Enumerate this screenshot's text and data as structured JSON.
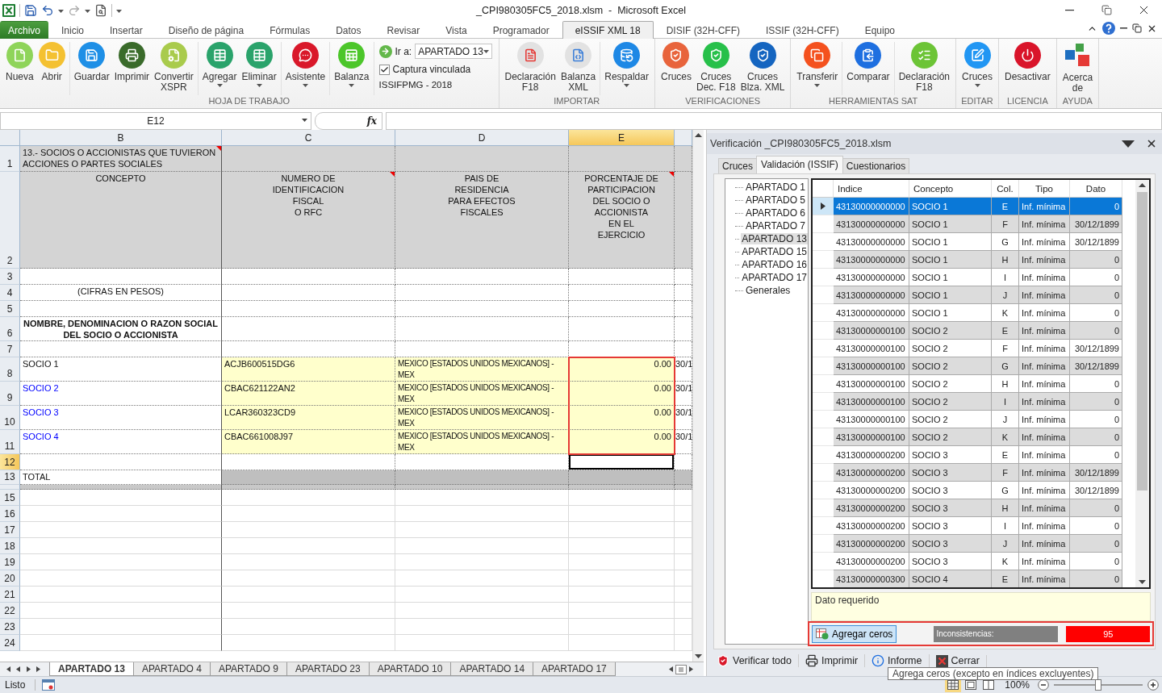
{
  "window": {
    "title": "_CPI980305FC5_2018.xlsm  -  Microsoft Excel"
  },
  "ribbon_tabs": [
    {
      "label": "Archivo",
      "kind": "file",
      "selected": false
    },
    {
      "label": "Inicio",
      "kind": "tab",
      "selected": false
    },
    {
      "label": "Insertar",
      "kind": "tab",
      "selected": false
    },
    {
      "label": "Diseño de página",
      "kind": "tab",
      "selected": false
    },
    {
      "label": "Fórmulas",
      "kind": "tab",
      "selected": false
    },
    {
      "label": "Datos",
      "kind": "tab",
      "selected": false
    },
    {
      "label": "Revisar",
      "kind": "tab",
      "selected": false
    },
    {
      "label": "Vista",
      "kind": "tab",
      "selected": false
    },
    {
      "label": "Programador",
      "kind": "tab",
      "selected": false
    },
    {
      "label": "eISSIF XML 18",
      "kind": "tab",
      "selected": true
    },
    {
      "label": "DISIF (32H-CFF)",
      "kind": "tab",
      "selected": false
    },
    {
      "label": "ISSIF (32H-CFF)",
      "kind": "tab",
      "selected": false
    },
    {
      "label": "Equipo",
      "kind": "tab",
      "selected": false
    }
  ],
  "ribbon_groups": [
    {
      "label": "HOJA DE TRABAJO",
      "sections": [
        [
          {
            "label": "Nueva",
            "kind": "round",
            "color": "#8fd45a",
            "dropdown": false
          },
          {
            "label": "Abrir",
            "kind": "round",
            "color": "#f4c132",
            "dropdown": false
          }
        ],
        [
          {
            "label": "Guardar",
            "kind": "round",
            "color": "#1e8fe6",
            "dropdown": false
          },
          {
            "label": "Imprimir",
            "kind": "round",
            "color": "#3a6b2b",
            "dropdown": false
          },
          {
            "label": "Convertir\nXSPR",
            "kind": "round",
            "color": "#a9cb4c",
            "dropdown": false
          }
        ],
        [
          {
            "label": "Agregar",
            "kind": "round",
            "color": "#2aa36b",
            "dropdown": true
          },
          {
            "label": "Eliminar",
            "kind": "round",
            "color": "#2aa36b",
            "dropdown": true
          }
        ],
        [
          {
            "label": "Asistente",
            "kind": "round",
            "color": "#d9182a",
            "dropdown": true
          }
        ],
        [
          {
            "label": "Balanza",
            "kind": "round",
            "color": "#4cc62a",
            "dropdown": true
          }
        ]
      ],
      "panel": {
        "goto_label": "Ir a:",
        "goto_value": "APARTADO 13",
        "checkbox_label": "Captura vinculada",
        "checked": true,
        "caption": "ISSIFPMG - 2018"
      }
    },
    {
      "label": "IMPORTAR",
      "sections": [
        [
          {
            "label": "Declaración\nF18",
            "kind": "round",
            "color": "#e2e2e2",
            "dropdown": false
          },
          {
            "label": "Balanza\nXML",
            "kind": "round",
            "color": "#e2e2e2",
            "dropdown": false
          }
        ],
        [
          {
            "label": "Respaldar",
            "kind": "round",
            "color": "#1e88e5",
            "dropdown": true
          }
        ]
      ]
    },
    {
      "label": "VERIFICACIONES",
      "sections": [
        [
          {
            "label": "Cruces",
            "kind": "round",
            "color": "#e8643c",
            "dropdown": false
          },
          {
            "label": "Cruces\nDec. F18",
            "kind": "round",
            "color": "#27c04a",
            "dropdown": false
          },
          {
            "label": "Cruces\nBlza. XML",
            "kind": "round",
            "color": "#1565c0",
            "dropdown": false
          }
        ]
      ]
    },
    {
      "label": "HERRAMIENTAS SAT",
      "sections": [
        [
          {
            "label": "Transferir",
            "kind": "round",
            "color": "#f4511e",
            "dropdown": true
          }
        ],
        [
          {
            "label": "Comparar",
            "kind": "round",
            "color": "#1e6fe0",
            "dropdown": false
          }
        ],
        [
          {
            "label": "Declaración\nF18",
            "kind": "round",
            "color": "#6cc436",
            "dropdown": false
          }
        ]
      ]
    },
    {
      "label": "EDITAR",
      "sections": [
        [
          {
            "label": "Cruces",
            "kind": "round",
            "color": "#2196f3",
            "dropdown": true
          }
        ]
      ]
    },
    {
      "label": "LICENCIA",
      "sections": [
        [
          {
            "label": "Desactivar",
            "kind": "round",
            "color": "#d9142a",
            "dropdown": false
          }
        ]
      ]
    },
    {
      "label": "AYUDA",
      "sections": [
        [
          {
            "label": "Acerca\nde",
            "kind": "tiles",
            "color": "#e53935",
            "dropdown": false
          }
        ]
      ]
    }
  ],
  "formula_bar": {
    "name_box": "E12",
    "fx_label": "fx"
  },
  "sheet": {
    "columns": [
      {
        "label": "B",
        "selected": false
      },
      {
        "label": "C",
        "selected": false
      },
      {
        "label": "D",
        "selected": false
      },
      {
        "label": "E",
        "selected": true
      },
      {
        "selected": false
      }
    ],
    "rows": [
      {
        "number": "1",
        "kind": "title",
        "selected": false,
        "cells": [
          "13.- SOCIOS O ACCIONISTAS QUE TUVIERON\nACCIONES O PARTES SOCIALES"
        ],
        "comments": [
          true,
          false,
          false,
          false,
          false
        ]
      },
      {
        "number": "2",
        "kind": "header",
        "selected": false,
        "cells": [
          "CONCEPTO",
          "NUMERO DE\nIDENTIFICACION\nFISCAL\nO RFC",
          "PAIS DE\nRESIDENCIA\nPARA EFECTOS\nFISCALES",
          "PORCENTAJE DE\nPARTICIPACION\nDEL SOCIO O\nACCIONISTA\nEN EL\nEJERCICIO"
        ],
        "comments": [
          false,
          true,
          false,
          true,
          false
        ]
      },
      {
        "number": "3",
        "kind": "blank",
        "selected": false,
        "cells": []
      },
      {
        "number": "4",
        "kind": "note",
        "selected": false,
        "cells": [
          "(CIFRAS EN PESOS)"
        ]
      },
      {
        "number": "5",
        "kind": "blank",
        "selected": false,
        "cells": []
      },
      {
        "number": "6",
        "kind": "heading",
        "selected": false,
        "cells": [
          "NOMBRE, DENOMINACION O RAZON SOCIAL\nDEL SOCIO O ACCIONISTA"
        ]
      },
      {
        "number": "7",
        "kind": "blank",
        "selected": false,
        "cells": []
      },
      {
        "number": "8",
        "kind": "data",
        "selected": false,
        "linked": false,
        "framed": true,
        "cells": [
          "SOCIO 1",
          "ACJB600515DG6",
          "MEXICO [ESTADOS UNIDOS MEXICANOS] -\nMEX",
          "0.00",
          "30/1"
        ]
      },
      {
        "number": "9",
        "kind": "data",
        "selected": false,
        "linked": true,
        "framed": true,
        "cells": [
          "SOCIO 2",
          "CBAC621122AN2",
          "MEXICO [ESTADOS UNIDOS MEXICANOS] -\nMEX",
          "0.00",
          "30/1"
        ]
      },
      {
        "number": "10",
        "kind": "data",
        "selected": false,
        "linked": true,
        "framed": true,
        "cells": [
          "SOCIO 3",
          "LCAR360323CD9",
          "MEXICO [ESTADOS UNIDOS MEXICANOS] -\nMEX",
          "0.00",
          "30/1"
        ]
      },
      {
        "number": "11",
        "kind": "data",
        "selected": false,
        "linked": true,
        "framed": true,
        "cells": [
          "SOCIO 4",
          "CBAC661008J97",
          "MEXICO [ESTADOS UNIDOS MEXICANOS] -\nMEX",
          "0.00",
          "30/1"
        ]
      },
      {
        "number": "12",
        "kind": "blank",
        "selected": true,
        "cells": []
      },
      {
        "number": "13",
        "kind": "total",
        "selected": false,
        "cells": [
          "TOTAL"
        ]
      },
      {
        "kind": "thin",
        "selected": false,
        "cells": []
      },
      {
        "number": "15",
        "kind": "plain",
        "selected": false,
        "cells": []
      },
      {
        "number": "16",
        "kind": "plain",
        "selected": false,
        "cells": []
      },
      {
        "number": "17",
        "kind": "plain",
        "selected": false,
        "cells": []
      },
      {
        "number": "18",
        "kind": "plain",
        "selected": false,
        "cells": []
      },
      {
        "number": "19",
        "kind": "plain",
        "selected": false,
        "cells": []
      },
      {
        "number": "20",
        "kind": "plain",
        "selected": false,
        "cells": []
      },
      {
        "number": "21",
        "kind": "plain",
        "selected": false,
        "cells": []
      },
      {
        "number": "22",
        "kind": "plain",
        "selected": false,
        "cells": []
      },
      {
        "number": "23",
        "kind": "plain",
        "selected": false,
        "cells": []
      },
      {
        "number": "24",
        "kind": "plain",
        "selected": false,
        "cells": []
      }
    ]
  },
  "sheet_tabs": [
    {
      "label": "APARTADO 13",
      "selected": true
    },
    {
      "label": "APARTADO 4",
      "selected": false
    },
    {
      "label": "APARTADO 9",
      "selected": false
    },
    {
      "label": "APARTADO 23",
      "selected": false
    },
    {
      "label": "APARTADO 10",
      "selected": false
    },
    {
      "label": "APARTADO 14",
      "selected": false
    },
    {
      "label": "APARTADO 17",
      "selected": false
    }
  ],
  "panel": {
    "title": "Verificación _CPI980305FC5_2018.xlsm",
    "tabs": [
      {
        "label": "Cruces",
        "selected": false
      },
      {
        "label": "Validación (ISSIF)",
        "selected": true
      },
      {
        "label": "Cuestionarios",
        "selected": false
      }
    ],
    "tree": [
      {
        "label": "APARTADO 1",
        "selected": false
      },
      {
        "label": "APARTADO 5",
        "selected": false
      },
      {
        "label": "APARTADO 6",
        "selected": false
      },
      {
        "label": "APARTADO 7",
        "selected": false
      },
      {
        "label": "APARTADO 13",
        "selected": true
      },
      {
        "label": "APARTADO 15",
        "selected": false
      },
      {
        "label": "APARTADO 16",
        "selected": false
      },
      {
        "label": "APARTADO 17",
        "selected": false
      },
      {
        "label": "Generales",
        "selected": false
      }
    ],
    "table": {
      "columns": [
        "Indice",
        "Concepto",
        "Col.",
        "Tipo",
        "Dato"
      ],
      "rows": [
        {
          "selected": true,
          "cells": [
            "43130000000000",
            "SOCIO 1",
            "E",
            "Inf. mínima",
            "0"
          ]
        },
        {
          "selected": false,
          "cells": [
            "43130000000000",
            "SOCIO 1",
            "F",
            "Inf. mínima",
            "30/12/1899"
          ]
        },
        {
          "selected": false,
          "cells": [
            "43130000000000",
            "SOCIO 1",
            "G",
            "Inf. mínima",
            "30/12/1899"
          ]
        },
        {
          "selected": false,
          "cells": [
            "43130000000000",
            "SOCIO 1",
            "H",
            "Inf. mínima",
            "0"
          ]
        },
        {
          "selected": false,
          "cells": [
            "43130000000000",
            "SOCIO 1",
            "I",
            "Inf. mínima",
            "0"
          ]
        },
        {
          "selected": false,
          "cells": [
            "43130000000000",
            "SOCIO 1",
            "J",
            "Inf. mínima",
            "0"
          ]
        },
        {
          "selected": false,
          "cells": [
            "43130000000000",
            "SOCIO 1",
            "K",
            "Inf. mínima",
            "0"
          ]
        },
        {
          "selected": false,
          "cells": [
            "43130000000100",
            "SOCIO 2",
            "E",
            "Inf. mínima",
            "0"
          ]
        },
        {
          "selected": false,
          "cells": [
            "43130000000100",
            "SOCIO 2",
            "F",
            "Inf. mínima",
            "30/12/1899"
          ]
        },
        {
          "selected": false,
          "cells": [
            "43130000000100",
            "SOCIO 2",
            "G",
            "Inf. mínima",
            "30/12/1899"
          ]
        },
        {
          "selected": false,
          "cells": [
            "43130000000100",
            "SOCIO 2",
            "H",
            "Inf. mínima",
            "0"
          ]
        },
        {
          "selected": false,
          "cells": [
            "43130000000100",
            "SOCIO 2",
            "I",
            "Inf. mínima",
            "0"
          ]
        },
        {
          "selected": false,
          "cells": [
            "43130000000100",
            "SOCIO 2",
            "J",
            "Inf. mínima",
            "0"
          ]
        },
        {
          "selected": false,
          "cells": [
            "43130000000100",
            "SOCIO 2",
            "K",
            "Inf. mínima",
            "0"
          ]
        },
        {
          "selected": false,
          "cells": [
            "43130000000200",
            "SOCIO 3",
            "E",
            "Inf. mínima",
            "0"
          ]
        },
        {
          "selected": false,
          "cells": [
            "43130000000200",
            "SOCIO 3",
            "F",
            "Inf. mínima",
            "30/12/1899"
          ]
        },
        {
          "selected": false,
          "cells": [
            "43130000000200",
            "SOCIO 3",
            "G",
            "Inf. mínima",
            "30/12/1899"
          ]
        },
        {
          "selected": false,
          "cells": [
            "43130000000200",
            "SOCIO 3",
            "H",
            "Inf. mínima",
            "0"
          ]
        },
        {
          "selected": false,
          "cells": [
            "43130000000200",
            "SOCIO 3",
            "I",
            "Inf. mínima",
            "0"
          ]
        },
        {
          "selected": false,
          "cells": [
            "43130000000200",
            "SOCIO 3",
            "J",
            "Inf. mínima",
            "0"
          ]
        },
        {
          "selected": false,
          "cells": [
            "43130000000200",
            "SOCIO 3",
            "K",
            "Inf. mínima",
            "0"
          ]
        },
        {
          "selected": false,
          "cells": [
            "43130000000300",
            "SOCIO 4",
            "E",
            "Inf. mínima",
            "0"
          ]
        }
      ]
    },
    "message": "Dato requerido",
    "actions": {
      "framed": true,
      "add_zeros": "Agregar ceros",
      "inconsistencies_label": "Inconsistencias:",
      "inconsistencies_count": "95"
    },
    "toolbar": [
      {
        "label": "Verificar todo",
        "kind": "verify"
      },
      {
        "label": "Imprimir",
        "kind": "print"
      },
      {
        "label": "Informe",
        "kind": "report"
      },
      {
        "label": "Cerrar",
        "kind": "close"
      }
    ],
    "tooltip": "Agrega ceros (excepto en índices excluyentes)"
  },
  "status_bar": {
    "text": "Listo",
    "zoom": "100%",
    "level": 0.5
  }
}
